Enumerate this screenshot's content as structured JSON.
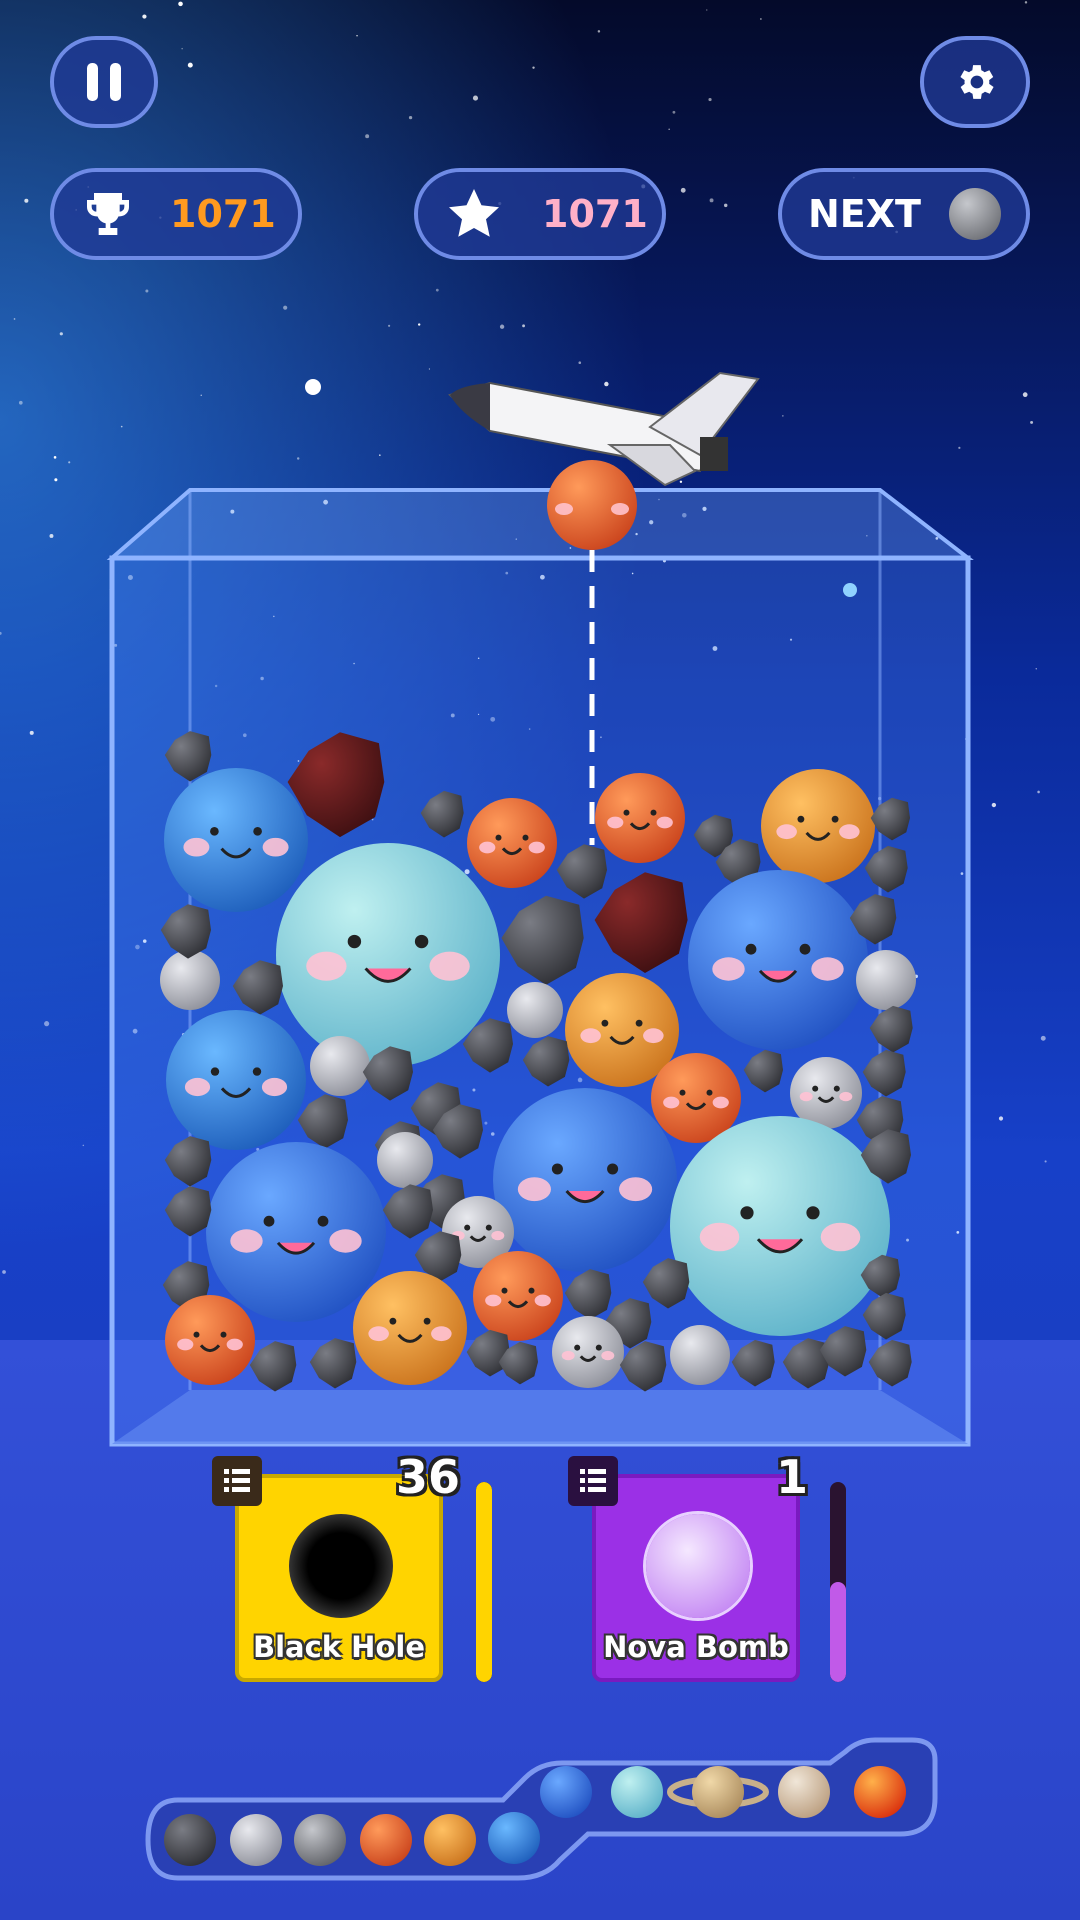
{
  "hud": {
    "best_score": "1071",
    "score": "1071",
    "next_label": "NEXT",
    "pause_icon": "pause-icon",
    "settings_icon": "gear-icon",
    "trophy_icon": "trophy-icon",
    "star_icon": "star-icon"
  },
  "powerups": [
    {
      "label": "Black Hole",
      "count": "36",
      "meter": 1.0,
      "color": "#ffd400",
      "meter_color": "#ffd400"
    },
    {
      "label": "Nova Bomb",
      "count": "1",
      "meter": 0.5,
      "color": "#9b30e6",
      "meter_color": "#c15ae8"
    }
  ],
  "evolution_icons": [
    "asteroid",
    "moon",
    "mercury",
    "mars",
    "venus",
    "earth",
    "neptune",
    "uranus",
    "saturn",
    "jupiter",
    "sun"
  ],
  "colors": {
    "accent": "#ff9a1f",
    "score_pink": "#ffb0c8",
    "panel_border": "#6f8be6"
  }
}
